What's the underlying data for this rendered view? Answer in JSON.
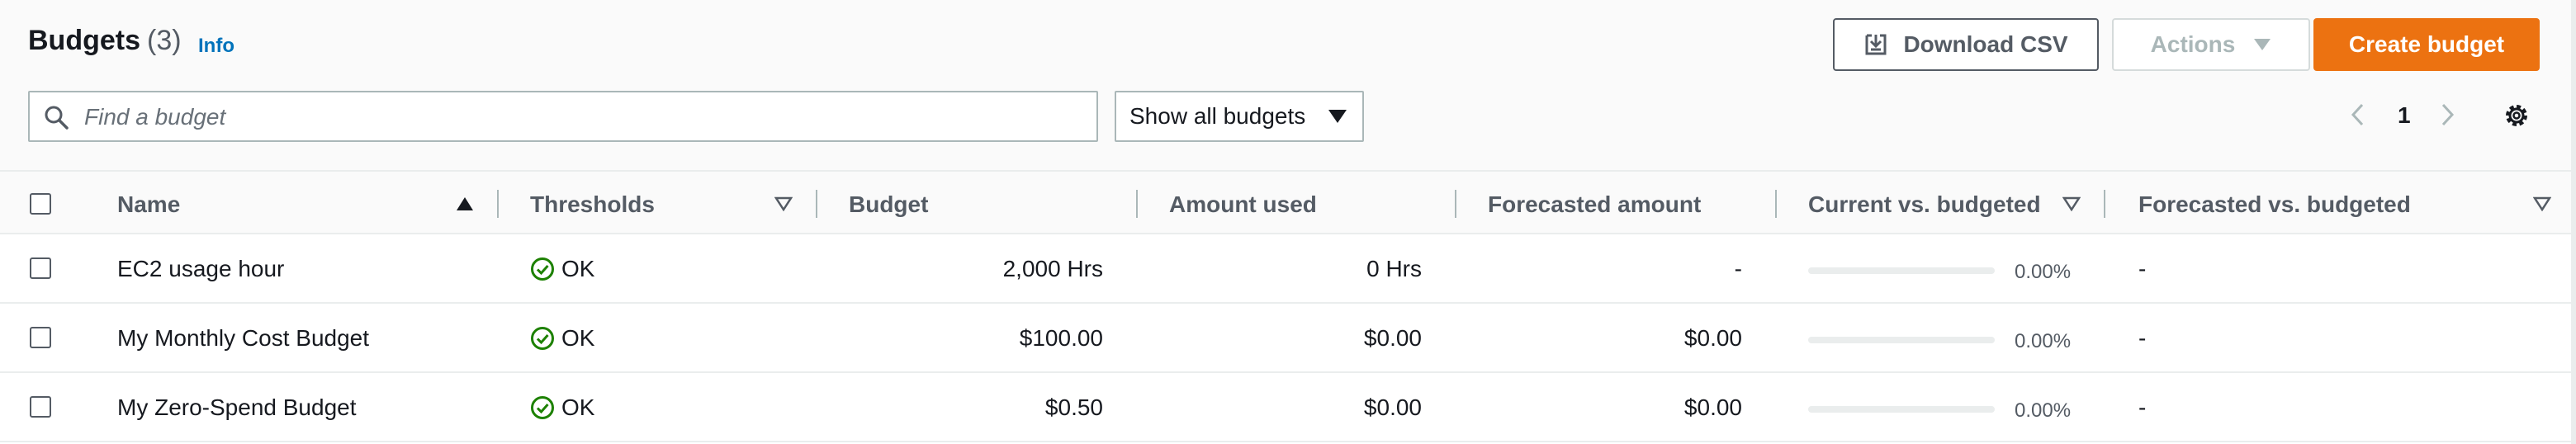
{
  "header": {
    "title": "Budgets",
    "count": "(3)",
    "info_label": "Info",
    "download_label": "Download CSV",
    "actions_label": "Actions",
    "create_label": "Create budget"
  },
  "search": {
    "placeholder": "Find a budget",
    "value": ""
  },
  "filter": {
    "selected": "Show all budgets"
  },
  "pagination": {
    "current_page": "1"
  },
  "icons": {
    "download": "download-icon",
    "search": "search-icon",
    "caret": "caret-down-icon",
    "prev": "chevron-left-icon",
    "next": "chevron-right-icon",
    "settings": "gear-icon",
    "status_ok": "check-circle-icon"
  },
  "table": {
    "columns": [
      "Name",
      "Thresholds",
      "Budget",
      "Amount used",
      "Forecasted amount",
      "Current vs. budgeted",
      "Forecasted vs. budgeted"
    ],
    "rows": [
      {
        "name": "EC2 usage hour",
        "thresholds": "OK",
        "budget": "2,000 Hrs",
        "amount_used": "0 Hrs",
        "forecasted": "-",
        "current_pct": "0.00%",
        "current_fill": 0.0,
        "forecast_vs": "-"
      },
      {
        "name": "My Monthly Cost Budget",
        "thresholds": "OK",
        "budget": "$100.00",
        "amount_used": "$0.00",
        "forecasted": "$0.00",
        "current_pct": "0.00%",
        "current_fill": 0.0,
        "forecast_vs": "-"
      },
      {
        "name": "My Zero-Spend Budget",
        "thresholds": "OK",
        "budget": "$0.50",
        "amount_used": "$0.00",
        "forecasted": "$0.00",
        "current_pct": "0.00%",
        "current_fill": 0.0,
        "forecast_vs": "-"
      }
    ]
  },
  "colors": {
    "accent": "#ec7211",
    "link": "#0073bb",
    "success": "#1d8102",
    "text": "#16191f",
    "muted": "#545b64",
    "border": "#aab7b8"
  }
}
